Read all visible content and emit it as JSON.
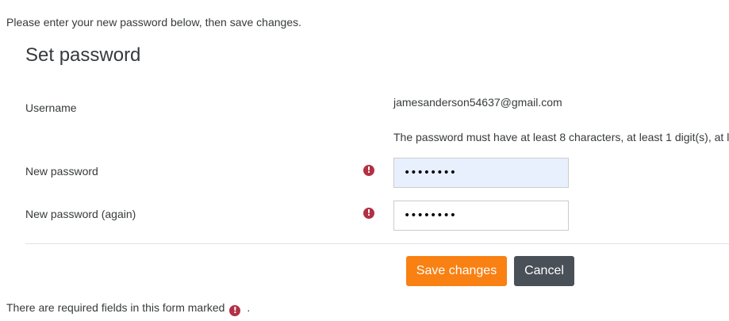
{
  "intro_text": "Please enter your new password below, then save changes.",
  "form": {
    "title": "Set password",
    "username_label": "Username",
    "username_value": "jamesanderson54637@gmail.com",
    "password_hint": "The password must have at least 8 characters, at least 1 digit(s), at l",
    "new_password_label": "New password",
    "new_password_value": "••••••••",
    "new_password_again_label": "New password (again)",
    "new_password_again_value": "••••••••",
    "required_icon_glyph": "!",
    "save_label": "Save changes",
    "cancel_label": "Cancel"
  },
  "footer": {
    "required_text": "There are required fields in this form marked",
    "trailing": "."
  },
  "colors": {
    "accent": "#f98012",
    "secondary_button": "#495057",
    "required_icon": "#b23045",
    "autofill_bg": "#e8f0fe"
  },
  "icons": {
    "required": "exclamation-circle-icon"
  }
}
